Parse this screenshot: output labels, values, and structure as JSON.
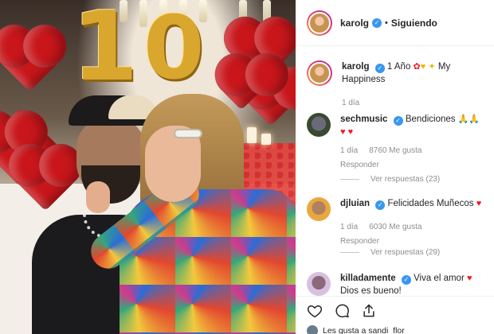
{
  "header": {
    "username": "karolg",
    "separator": "•",
    "follow_status": "Siguiendo"
  },
  "caption": {
    "username": "karolg",
    "text": "1 Año",
    "text2": "My Happiness",
    "emojis": [
      "rose-emoji",
      "yellow-heart-emoji",
      "sparkles-emoji"
    ],
    "time": "1 día"
  },
  "comments": [
    {
      "username": "sechmusic",
      "text": "Bendiciones",
      "emojis_inline": [
        "praying-hands-emoji",
        "praying-hands-emoji"
      ],
      "emojis_line2": [
        "red-heart-emoji",
        "red-heart-emoji"
      ],
      "time": "1 día",
      "likes": "8760 Me gusta",
      "reply_label": "Responder",
      "view_replies": "Ver respuestas (23)"
    },
    {
      "username": "djluian",
      "text": "Felicidades Muñecos",
      "emojis_inline": [
        "red-heart-emoji"
      ],
      "time": "1 día",
      "likes": "6030 Me gusta",
      "reply_label": "Responder",
      "view_replies": "Ver respuestas (29)"
    },
    {
      "username": "killadamente",
      "text": "Viva el amor",
      "text2": "Dios es bueno!",
      "emojis_inline": [
        "heart-emoji"
      ]
    }
  ],
  "actions": {
    "like_icon": "heart-outline-icon",
    "comment_icon": "comment-icon",
    "share_icon": "share-icon"
  },
  "likes_line": "Les gusta a sandi_flor_",
  "photo": {
    "balloon_letters": [
      "1",
      "0"
    ],
    "colors": {
      "balloon_red": "#c8161b",
      "gold": "#d9a62e",
      "ig_blue": "#3897f0",
      "muted": "#8e8e8e"
    }
  }
}
